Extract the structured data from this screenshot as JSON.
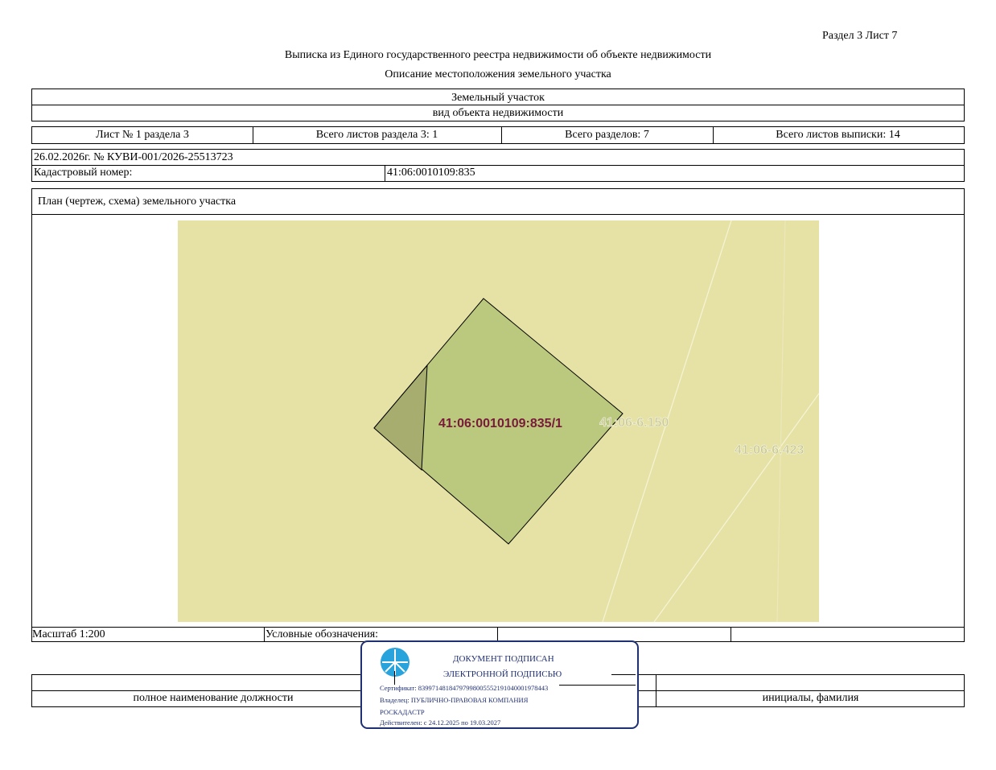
{
  "header": {
    "section_sheet": "Раздел 3    Лист 7",
    "title": "Выписка из Единого государственного реестра недвижимости об объекте недвижимости",
    "subtitle": "Описание местоположения земельного участка"
  },
  "object": {
    "type": "Земельный участок",
    "type_caption": "вид объекта недвижимости"
  },
  "sheet_info": {
    "sheet": "Лист № 1 раздела 3",
    "total_sheets_section": "Всего листов раздела 3: 1",
    "total_sections": "Всего разделов: 7",
    "total_sheets_extract": "Всего листов выписки: 14"
  },
  "record": {
    "date_number": "26.02.2026г. № КУВИ-001/2026-25513723",
    "cadastral_label": "Кадастровый номер:",
    "cadastral_value": "41:06:0010109:835"
  },
  "plan": {
    "heading": "План (чертеж, схема) земельного участка",
    "labels": {
      "parcel_part": "41:06:0010109:835/1",
      "block_a": "41:06-6.150",
      "block_b": "41:06-6.423"
    },
    "colors": {
      "background": "#e6e2a6",
      "parcel": "#bac97d",
      "part": "#a6ad6e",
      "part_label": "#7a1a3a",
      "zone_label": "#c8c892"
    }
  },
  "footer": {
    "scale": "Масштаб 1:200",
    "legend_label": "Условные обозначения:",
    "position_caption": "полное наименование должности",
    "name_caption": "инициалы, фамилия"
  },
  "stamp": {
    "line1": "ДОКУМЕНТ ПОДПИСАН",
    "line2": "ЭЛЕКТРОННОЙ ПОДПИСЬЮ",
    "certificate": "Сертификат: 83997148184797998005552191040001978443",
    "owner": "Владелец: ПУБЛИЧНО-ПРАВОВАЯ КОМПАНИЯ",
    "owner2": "РОСКАДАСТР",
    "valid": "Действителен: с 24.12.2025 по 19.03.2027",
    "border_color": "#1f2f73",
    "logo_color": "#29a3dc"
  }
}
